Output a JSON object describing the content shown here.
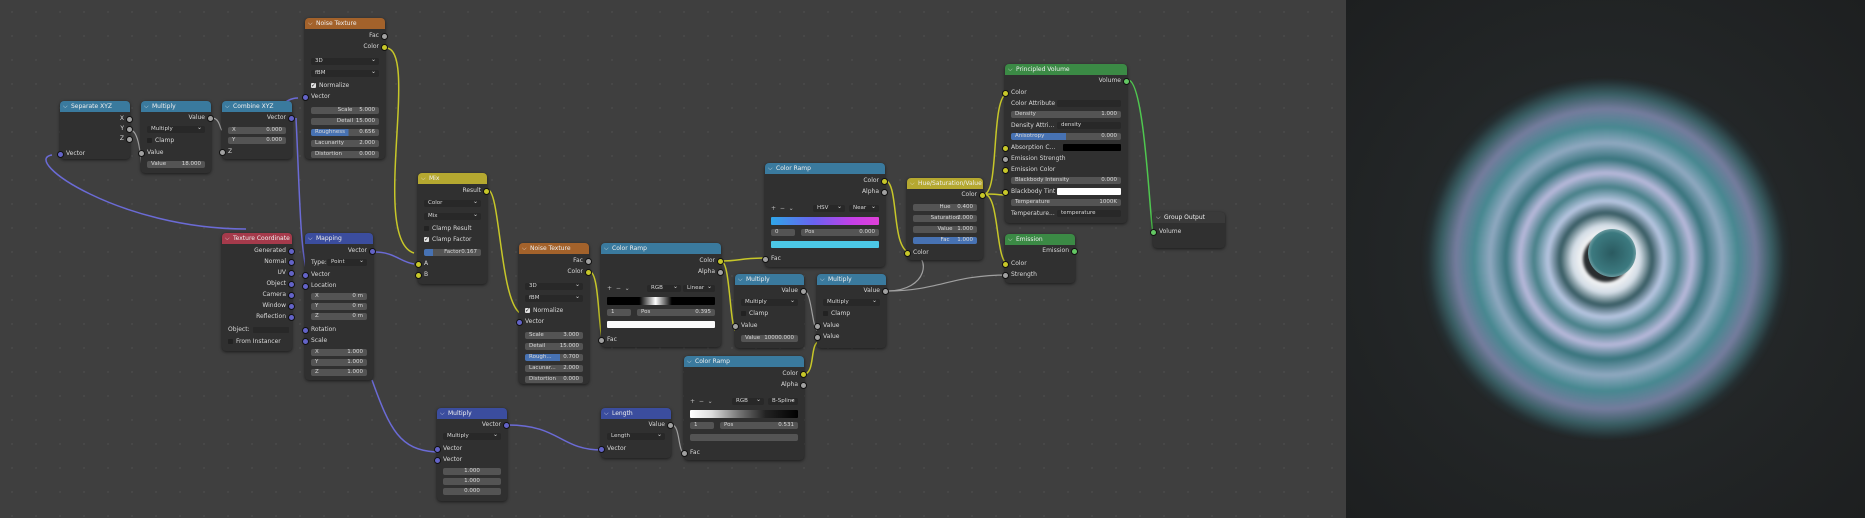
{
  "editor": {
    "nodes": {
      "separate_xyz": {
        "title": "Separate XYZ",
        "outputs": [
          "X",
          "Y",
          "Z"
        ],
        "input": "Vector"
      },
      "multiply1": {
        "title": "Multiply",
        "output": "Value",
        "op": "Multiply",
        "clamp": "Clamp",
        "value_label": "Value",
        "in1": "Value",
        "value": "18.000"
      },
      "combine_xyz": {
        "title": "Combine XYZ",
        "output": "Vector",
        "x_label": "X",
        "x": "0.000",
        "y_label": "Y",
        "y": "0.000",
        "z_label": "Z"
      },
      "noise1": {
        "title": "Noise Texture",
        "out_fac": "Fac",
        "out_color": "Color",
        "dim": "3D",
        "type": "fBM",
        "normalize": "Normalize",
        "vector": "Vector",
        "scale_label": "Scale",
        "scale": "5.000",
        "detail_label": "Detail",
        "detail": "15.000",
        "rough_label": "Roughness",
        "rough": "0.656",
        "lac_label": "Lacunarity",
        "lac": "2.000",
        "dist_label": "Distortion",
        "dist": "0.000"
      },
      "tex_coord": {
        "title": "Texture Coordinate",
        "outputs": [
          "Generated",
          "Normal",
          "UV",
          "Object",
          "Camera",
          "Window",
          "Reflection"
        ],
        "object_label": "Object:",
        "from_instancer": "From Instancer"
      },
      "mapping": {
        "title": "Mapping",
        "output": "Vector",
        "type_label": "Type:",
        "type": "Point",
        "vector": "Vector",
        "location": "Location",
        "lx": "X",
        "lxv": "0 m",
        "ly": "Y",
        "lyv": "0 m",
        "lz": "Z",
        "lzv": "0 m",
        "rotation": "Rotation",
        "scale": "Scale",
        "sx": "X",
        "sxv": "1.000",
        "sy": "Y",
        "syv": "1.000",
        "sz": "Z",
        "szv": "1.000"
      },
      "mix": {
        "title": "Mix",
        "output": "Result",
        "data_type": "Color",
        "blend": "Mix",
        "clamp_result": "Clamp Result",
        "clamp_factor": "Clamp Factor",
        "factor_label": "Factor",
        "factor": "0.167",
        "a": "A",
        "b": "B"
      },
      "noise2": {
        "title": "Noise Texture",
        "out_fac": "Fac",
        "out_color": "Color",
        "dim": "3D",
        "type": "fBM",
        "normalize": "Normalize",
        "vector": "Vector",
        "scale_label": "Scale",
        "scale": "3.000",
        "detail_label": "Detail",
        "detail": "15.000",
        "rough_label": "Rough...",
        "rough": "0.700",
        "lac_label": "Lacunar...",
        "lac": "2.000",
        "dist_label": "Distortion",
        "dist": "0.000"
      },
      "ramp1": {
        "title": "Color Ramp",
        "out_color": "Color",
        "out_alpha": "Alpha",
        "mode": "RGB",
        "interp": "Linear",
        "index": "1",
        "pos_label": "Pos",
        "pos": "0.395",
        "fac": "Fac"
      },
      "ramp_top": {
        "title": "Color Ramp",
        "out_color": "Color",
        "out_alpha": "Alpha",
        "mode": "HSV",
        "interp": "Near",
        "index": "0",
        "pos_label": "Pos",
        "pos": "0.000",
        "fac": "Fac"
      },
      "multiply2": {
        "title": "Multiply",
        "output": "Value",
        "op": "Multiply",
        "clamp": "Clamp",
        "in1": "Value",
        "value_label": "Value",
        "value": "10000.000"
      },
      "multiply3": {
        "title": "Multiply",
        "output": "Value",
        "op": "Multiply",
        "clamp": "Clamp",
        "in1": "Value",
        "in2": "Value"
      },
      "ramp3": {
        "title": "Color Ramp",
        "out_color": "Color",
        "out_alpha": "Alpha",
        "mode": "RGB",
        "interp": "B-Spline",
        "index": "1",
        "pos_label": "Pos",
        "pos": "0.531",
        "fac": "Fac"
      },
      "hue_sat": {
        "title": "Hue/Saturation/Value",
        "output": "Color",
        "hue_label": "Hue",
        "hue": "0.400",
        "sat_label": "Saturation",
        "sat": "2.000",
        "val_label": "Value",
        "val": "1.000",
        "fac_label": "Fac",
        "fac": "1.000",
        "color": "Color"
      },
      "principled": {
        "title": "Principled Volume",
        "output": "Volume",
        "color": "Color",
        "color_attr": "Color Attribute",
        "density_label": "Density",
        "density": "1.000",
        "density_attr_label": "Density Attri...",
        "density_attr": "density",
        "aniso_label": "Anisotropy",
        "aniso": "0.000",
        "absorb": "Absorption C...",
        "emission_strength": "Emission Strength",
        "emission_color": "Emission Color",
        "blackbody_label": "Blackbody Intensity",
        "blackbody": "0.000",
        "blackbody_tint": "Blackbody Tint",
        "temp_label": "Temperature",
        "temp": "1000K",
        "temp_attr_label": "Temperature...",
        "temp_attr": "temperature"
      },
      "emission": {
        "title": "Emission",
        "output": "Emission",
        "color": "Color",
        "strength": "Strength"
      },
      "group_output": {
        "title": "Group Output",
        "input": "Volume"
      },
      "multiply4": {
        "title": "Multiply",
        "output": "Vector",
        "op": "Multiply",
        "v1": "Vector",
        "v2": "Vector",
        "x": "1.000",
        "y": "1.000",
        "z": "0.000"
      },
      "length": {
        "title": "Length",
        "output": "Value",
        "op": "Length",
        "vector": "Vector"
      }
    }
  },
  "colors": {
    "wire_color": "#c7c729",
    "wire_vector": "#6b6bd6",
    "wire_float": "#a0a0a0",
    "wire_shader": "#4fc74f"
  }
}
